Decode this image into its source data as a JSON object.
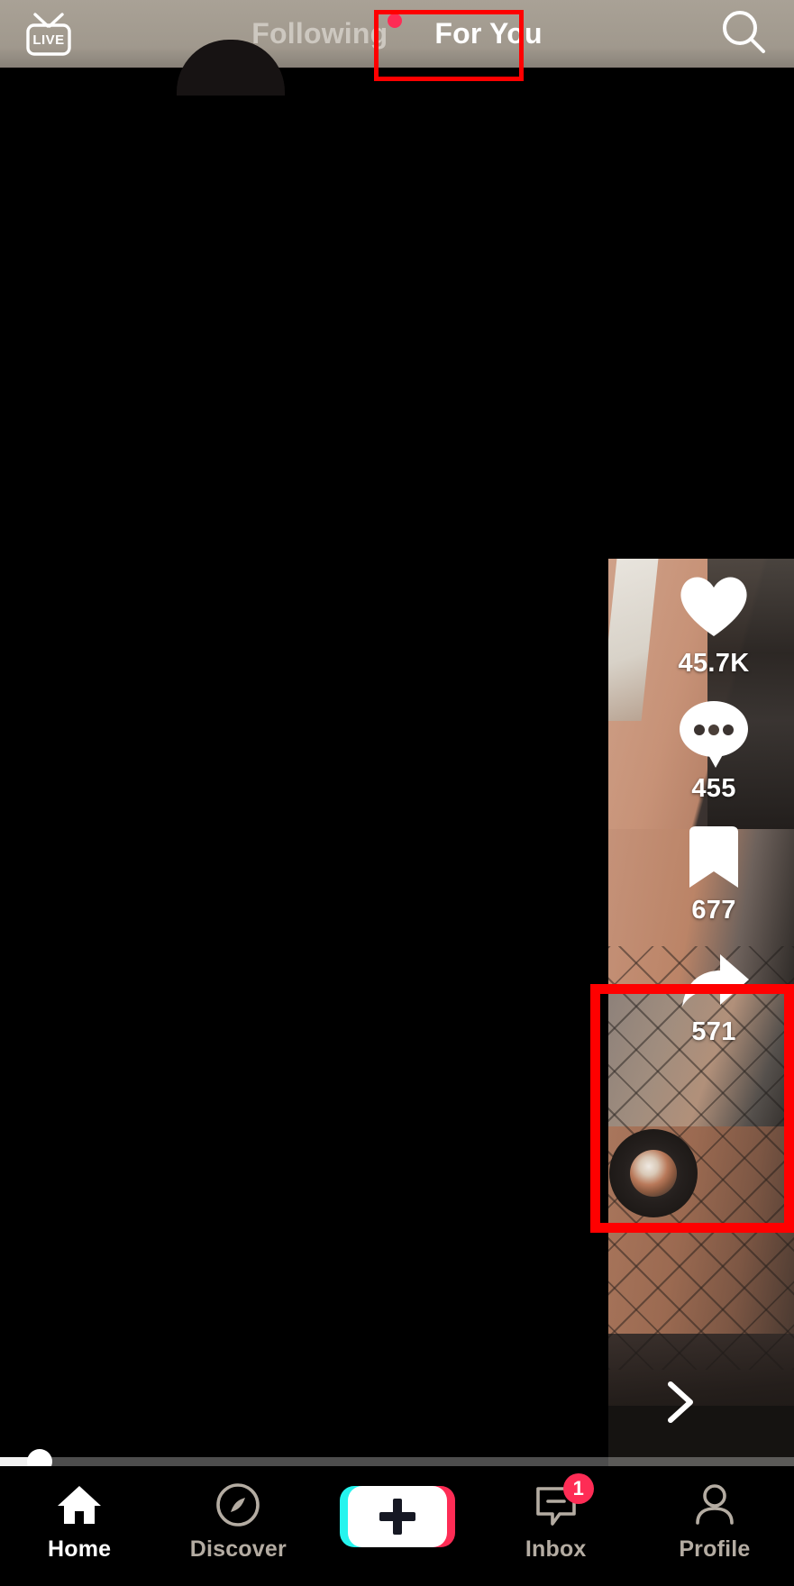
{
  "app": {
    "name": "TikTok",
    "accent_cyan": "#25f4ee",
    "accent_red": "#fe2c55",
    "annotation_color": "#ff0000"
  },
  "topbar": {
    "live_label": "LIVE",
    "live_icon": "live-tv-icon",
    "search_icon": "search-icon",
    "tabs": [
      {
        "label": "Following",
        "active": false,
        "has_dot": true
      },
      {
        "label": "For You",
        "active": true,
        "has_dot": false
      }
    ]
  },
  "rail": {
    "items": [
      {
        "name": "like",
        "icon": "heart-icon",
        "count": "45.7K"
      },
      {
        "name": "comment",
        "icon": "comment-bubble-icon",
        "count": "455"
      },
      {
        "name": "save",
        "icon": "bookmark-icon",
        "count": "677"
      },
      {
        "name": "share",
        "icon": "share-arrow-icon",
        "count": "571"
      }
    ],
    "avatar_icon": "music-disc-avatar"
  },
  "player": {
    "next_icon": "chevron-right-icon",
    "progress_percent": 5
  },
  "bottom_nav": {
    "items": [
      {
        "label": "Home",
        "icon": "home-icon",
        "active": true
      },
      {
        "label": "Discover",
        "icon": "compass-icon",
        "active": false
      },
      {
        "label": "Inbox",
        "icon": "inbox-icon",
        "active": false,
        "badge": "1"
      },
      {
        "label": "Profile",
        "icon": "person-icon",
        "active": false
      }
    ],
    "create_icon": "plus-icon"
  }
}
